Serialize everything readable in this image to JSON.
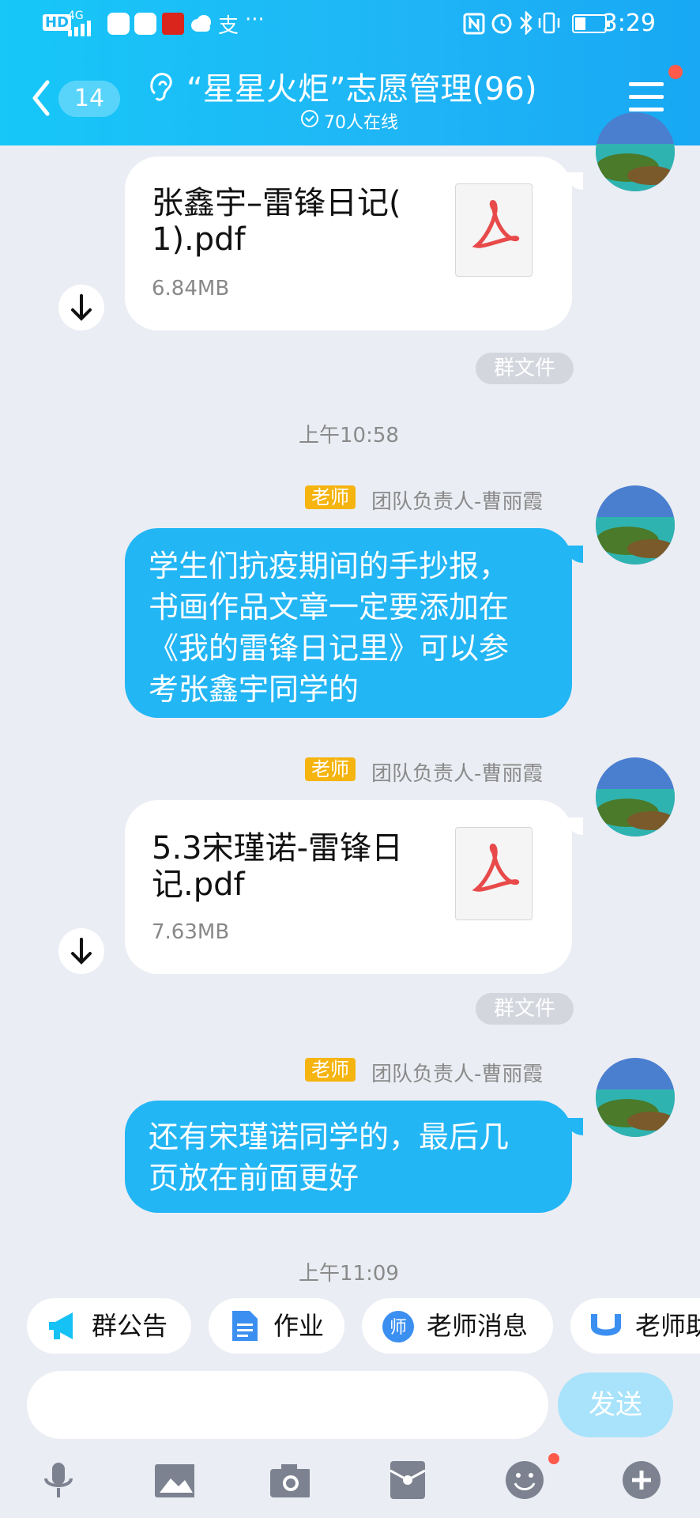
{
  "status_bar": {
    "left_icons": [
      "hd-icon",
      "4g-signal-icon",
      "app-icon",
      "app-icon",
      "news-app-icon",
      "cloud-icon",
      "alipay-icon",
      "more-icon"
    ],
    "alipay_glyph": "支",
    "more_glyph": "···",
    "hd_label": "HD",
    "net_label": "4G",
    "time": "3:29",
    "battery_level": 0.35
  },
  "header": {
    "back_count": "14",
    "title": "“星星火炬”志愿管理(96)",
    "online": "70人在线",
    "menu_badge": true
  },
  "messages": {
    "file1": {
      "name_line1": "张鑫宇–雷锋日记(",
      "name_line2": "1).pdf",
      "size": "6.84MB"
    },
    "file1_tag": "群文件",
    "time1": "上午10:58",
    "msg1_badge": "老师",
    "msg1_sender": "团队负责人-曹丽霞",
    "msg1_lines": [
      "学生们抗疫期间的手抄报，",
      "书画作品文章一定要添加在",
      "《我的雷锋日记里》可以参",
      "考张鑫宇同学的"
    ],
    "msg2_badge": "老师",
    "msg2_sender": "团队负责人-曹丽霞",
    "file2": {
      "name_line1": "5.3宋瑾诺-雷锋日",
      "name_line2": "记.pdf",
      "size": "7.63MB"
    },
    "file2_tag": "群文件",
    "msg3_badge": "老师",
    "msg3_sender": "团队负责人-曹丽霞",
    "msg3_lines": [
      "还有宋瑾诺同学的，最后几",
      "页放在前面更好"
    ],
    "time2": "上午11:09"
  },
  "quick_bar": {
    "chips": [
      "群公告",
      "作业",
      "老师消息",
      "老师助"
    ]
  },
  "input": {
    "placeholder": "",
    "send_label": "发送"
  },
  "colors": {
    "header": "#1fb6f6",
    "bubble_blue": "#23b6f5",
    "teacher_badge": "#f5b40f",
    "background": "#ebedf4"
  }
}
